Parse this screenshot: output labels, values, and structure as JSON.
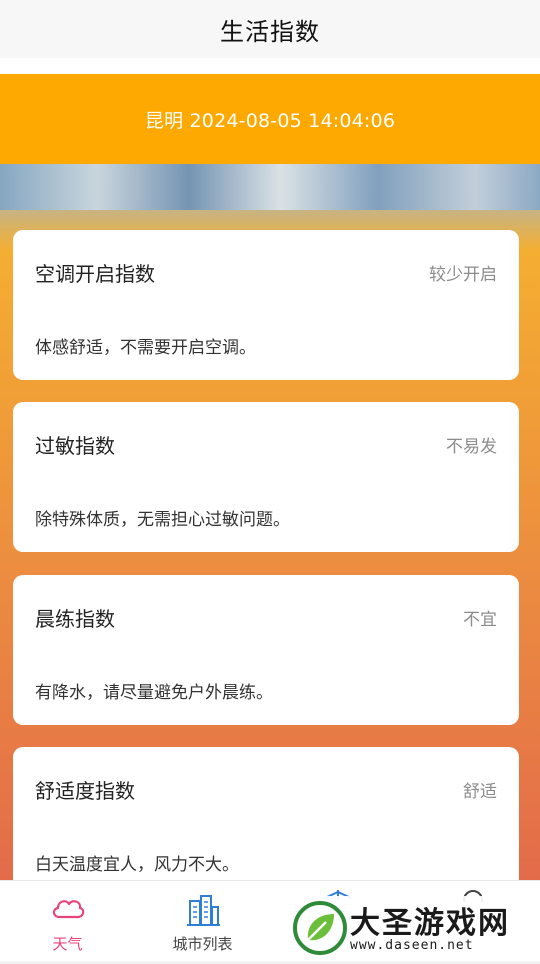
{
  "header": {
    "title": "生活指数"
  },
  "banner": {
    "text": "昆明 2024-08-05 14:04:06"
  },
  "cards": [
    {
      "title": "空调开启指数",
      "level": "较少开启",
      "desc": "体感舒适，不需要开启空调。"
    },
    {
      "title": "过敏指数",
      "level": "不易发",
      "desc": "除特殊体质，无需担心过敏问题。"
    },
    {
      "title": "晨练指数",
      "level": "不宜",
      "desc": "有降水，请尽量避免户外晨练。"
    },
    {
      "title": "舒适度指数",
      "level": "舒适",
      "desc": "白天温度宜人，风力不大。"
    }
  ],
  "tabs": [
    {
      "label": "天气",
      "icon": "cloud-icon"
    },
    {
      "label": "城市列表",
      "icon": "buildings-icon"
    },
    {
      "label": "",
      "icon": "airplane-icon"
    },
    {
      "label": "",
      "icon": "user-icon"
    }
  ],
  "watermark": {
    "name": "大圣游戏网",
    "url": "www.daseen.net"
  },
  "colors": {
    "banner": "#fea902",
    "active_tab": "#e6457a",
    "building_icon": "#2f7fd8"
  }
}
